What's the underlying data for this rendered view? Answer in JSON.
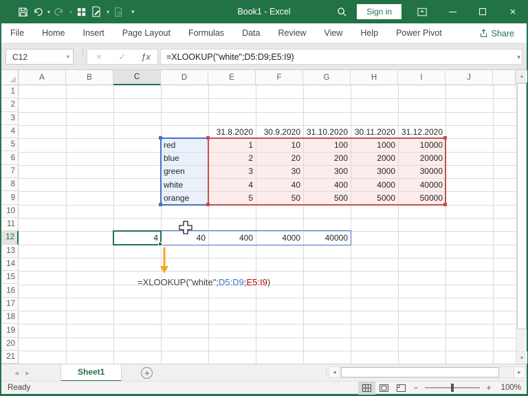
{
  "titlebar": {
    "title": "Book1  -  Excel",
    "sign_in_label": "Sign in"
  },
  "ribbon": {
    "tabs": [
      "File",
      "Home",
      "Insert",
      "Page Layout",
      "Formulas",
      "Data",
      "Review",
      "View",
      "Help",
      "Power Pivot"
    ],
    "share_label": "Share"
  },
  "formula_bar": {
    "name_box": "C12",
    "formula": "=XLOOKUP(\"white\";D5:D9;E5:I9)"
  },
  "grid": {
    "columns": [
      "A",
      "B",
      "C",
      "D",
      "E",
      "F",
      "G",
      "H",
      "I",
      "J"
    ],
    "row_count": 21,
    "selected_column": "C",
    "selected_row": 12
  },
  "cells": [
    {
      "ref": "E4",
      "v": "31.8.2020",
      "a": "r"
    },
    {
      "ref": "F4",
      "v": "30.9.2020",
      "a": "r"
    },
    {
      "ref": "G4",
      "v": "31.10.2020",
      "a": "r"
    },
    {
      "ref": "H4",
      "v": "30.11.2020",
      "a": "r"
    },
    {
      "ref": "I4",
      "v": "31.12.2020",
      "a": "r"
    },
    {
      "ref": "D5",
      "v": "red",
      "a": "l"
    },
    {
      "ref": "E5",
      "v": "1",
      "a": "r"
    },
    {
      "ref": "F5",
      "v": "10",
      "a": "r"
    },
    {
      "ref": "G5",
      "v": "100",
      "a": "r"
    },
    {
      "ref": "H5",
      "v": "1000",
      "a": "r"
    },
    {
      "ref": "I5",
      "v": "10000",
      "a": "r"
    },
    {
      "ref": "D6",
      "v": "blue",
      "a": "l"
    },
    {
      "ref": "E6",
      "v": "2",
      "a": "r"
    },
    {
      "ref": "F6",
      "v": "20",
      "a": "r"
    },
    {
      "ref": "G6",
      "v": "200",
      "a": "r"
    },
    {
      "ref": "H6",
      "v": "2000",
      "a": "r"
    },
    {
      "ref": "I6",
      "v": "20000",
      "a": "r"
    },
    {
      "ref": "D7",
      "v": "green",
      "a": "l"
    },
    {
      "ref": "E7",
      "v": "3",
      "a": "r"
    },
    {
      "ref": "F7",
      "v": "30",
      "a": "r"
    },
    {
      "ref": "G7",
      "v": "300",
      "a": "r"
    },
    {
      "ref": "H7",
      "v": "3000",
      "a": "r"
    },
    {
      "ref": "I7",
      "v": "30000",
      "a": "r"
    },
    {
      "ref": "D8",
      "v": "white",
      "a": "l"
    },
    {
      "ref": "E8",
      "v": "4",
      "a": "r"
    },
    {
      "ref": "F8",
      "v": "40",
      "a": "r"
    },
    {
      "ref": "G8",
      "v": "400",
      "a": "r"
    },
    {
      "ref": "H8",
      "v": "4000",
      "a": "r"
    },
    {
      "ref": "I8",
      "v": "40000",
      "a": "r"
    },
    {
      "ref": "D9",
      "v": "orange",
      "a": "l"
    },
    {
      "ref": "E9",
      "v": "5",
      "a": "r"
    },
    {
      "ref": "F9",
      "v": "50",
      "a": "r"
    },
    {
      "ref": "G9",
      "v": "500",
      "a": "r"
    },
    {
      "ref": "H9",
      "v": "5000",
      "a": "r"
    },
    {
      "ref": "I9",
      "v": "50000",
      "a": "r"
    },
    {
      "ref": "C12",
      "v": "4",
      "a": "r"
    },
    {
      "ref": "D12",
      "v": "40",
      "a": "r"
    },
    {
      "ref": "E12",
      "v": "400",
      "a": "r"
    },
    {
      "ref": "F12",
      "v": "4000",
      "a": "r"
    },
    {
      "ref": "G12",
      "v": "40000",
      "a": "r"
    }
  ],
  "ranges": [
    {
      "ref": "D5:D9",
      "name": "lookup-array-range",
      "border": "#4472C4",
      "bg": "#EAF1FB",
      "width": 2,
      "handles": true
    },
    {
      "ref": "E5:I9",
      "name": "return-array-range",
      "border": "#C0504D",
      "bg": "#FCECEB",
      "width": 2,
      "handles": true
    },
    {
      "ref": "C12:G12",
      "name": "spill-range",
      "border": "#4472C4",
      "width": 1
    },
    {
      "ref": "C12",
      "name": "active-cell",
      "border": "#217346",
      "width": 2,
      "active": true
    }
  ],
  "annotation": {
    "parts": [
      {
        "t": "=XLOOKUP(\"white\";",
        "c": "#404040"
      },
      {
        "t": "D5:D9",
        "c": "#4472C4"
      },
      {
        "t": ";",
        "c": "#404040"
      },
      {
        "t": "E5:I9",
        "c": "#C00000"
      },
      {
        "t": ")",
        "c": "#404040"
      }
    ],
    "arrow_color": "#F5A623"
  },
  "sheet_tabs": {
    "active": "Sheet1"
  },
  "status_bar": {
    "status": "Ready",
    "zoom_label": "100%"
  },
  "colors": {
    "accent_green": "#217346",
    "ref_blue": "#4472C4",
    "ref_red": "#C0504D"
  },
  "icons": {
    "chevron_down": "▾",
    "arrow_left": "◂",
    "arrow_right": "▸",
    "arrow_up": "▴",
    "cancel": "×",
    "check": "✓",
    "fx": "ƒx",
    "minus": "−",
    "plus": "+",
    "dots": "⋮",
    "close": "×"
  }
}
